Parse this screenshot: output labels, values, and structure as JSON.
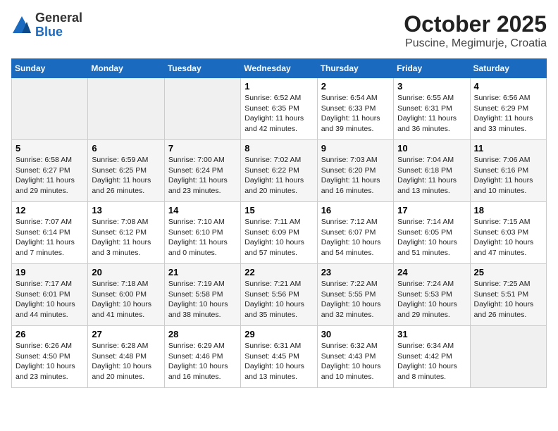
{
  "header": {
    "logo_general": "General",
    "logo_blue": "Blue",
    "title": "October 2025",
    "subtitle": "Puscine, Megimurje, Croatia"
  },
  "days_of_week": [
    "Sunday",
    "Monday",
    "Tuesday",
    "Wednesday",
    "Thursday",
    "Friday",
    "Saturday"
  ],
  "weeks": [
    [
      {
        "num": "",
        "info": ""
      },
      {
        "num": "",
        "info": ""
      },
      {
        "num": "",
        "info": ""
      },
      {
        "num": "1",
        "info": "Sunrise: 6:52 AM\nSunset: 6:35 PM\nDaylight: 11 hours\nand 42 minutes."
      },
      {
        "num": "2",
        "info": "Sunrise: 6:54 AM\nSunset: 6:33 PM\nDaylight: 11 hours\nand 39 minutes."
      },
      {
        "num": "3",
        "info": "Sunrise: 6:55 AM\nSunset: 6:31 PM\nDaylight: 11 hours\nand 36 minutes."
      },
      {
        "num": "4",
        "info": "Sunrise: 6:56 AM\nSunset: 6:29 PM\nDaylight: 11 hours\nand 33 minutes."
      }
    ],
    [
      {
        "num": "5",
        "info": "Sunrise: 6:58 AM\nSunset: 6:27 PM\nDaylight: 11 hours\nand 29 minutes."
      },
      {
        "num": "6",
        "info": "Sunrise: 6:59 AM\nSunset: 6:25 PM\nDaylight: 11 hours\nand 26 minutes."
      },
      {
        "num": "7",
        "info": "Sunrise: 7:00 AM\nSunset: 6:24 PM\nDaylight: 11 hours\nand 23 minutes."
      },
      {
        "num": "8",
        "info": "Sunrise: 7:02 AM\nSunset: 6:22 PM\nDaylight: 11 hours\nand 20 minutes."
      },
      {
        "num": "9",
        "info": "Sunrise: 7:03 AM\nSunset: 6:20 PM\nDaylight: 11 hours\nand 16 minutes."
      },
      {
        "num": "10",
        "info": "Sunrise: 7:04 AM\nSunset: 6:18 PM\nDaylight: 11 hours\nand 13 minutes."
      },
      {
        "num": "11",
        "info": "Sunrise: 7:06 AM\nSunset: 6:16 PM\nDaylight: 11 hours\nand 10 minutes."
      }
    ],
    [
      {
        "num": "12",
        "info": "Sunrise: 7:07 AM\nSunset: 6:14 PM\nDaylight: 11 hours\nand 7 minutes."
      },
      {
        "num": "13",
        "info": "Sunrise: 7:08 AM\nSunset: 6:12 PM\nDaylight: 11 hours\nand 3 minutes."
      },
      {
        "num": "14",
        "info": "Sunrise: 7:10 AM\nSunset: 6:10 PM\nDaylight: 11 hours\nand 0 minutes."
      },
      {
        "num": "15",
        "info": "Sunrise: 7:11 AM\nSunset: 6:09 PM\nDaylight: 10 hours\nand 57 minutes."
      },
      {
        "num": "16",
        "info": "Sunrise: 7:12 AM\nSunset: 6:07 PM\nDaylight: 10 hours\nand 54 minutes."
      },
      {
        "num": "17",
        "info": "Sunrise: 7:14 AM\nSunset: 6:05 PM\nDaylight: 10 hours\nand 51 minutes."
      },
      {
        "num": "18",
        "info": "Sunrise: 7:15 AM\nSunset: 6:03 PM\nDaylight: 10 hours\nand 47 minutes."
      }
    ],
    [
      {
        "num": "19",
        "info": "Sunrise: 7:17 AM\nSunset: 6:01 PM\nDaylight: 10 hours\nand 44 minutes."
      },
      {
        "num": "20",
        "info": "Sunrise: 7:18 AM\nSunset: 6:00 PM\nDaylight: 10 hours\nand 41 minutes."
      },
      {
        "num": "21",
        "info": "Sunrise: 7:19 AM\nSunset: 5:58 PM\nDaylight: 10 hours\nand 38 minutes."
      },
      {
        "num": "22",
        "info": "Sunrise: 7:21 AM\nSunset: 5:56 PM\nDaylight: 10 hours\nand 35 minutes."
      },
      {
        "num": "23",
        "info": "Sunrise: 7:22 AM\nSunset: 5:55 PM\nDaylight: 10 hours\nand 32 minutes."
      },
      {
        "num": "24",
        "info": "Sunrise: 7:24 AM\nSunset: 5:53 PM\nDaylight: 10 hours\nand 29 minutes."
      },
      {
        "num": "25",
        "info": "Sunrise: 7:25 AM\nSunset: 5:51 PM\nDaylight: 10 hours\nand 26 minutes."
      }
    ],
    [
      {
        "num": "26",
        "info": "Sunrise: 6:26 AM\nSunset: 4:50 PM\nDaylight: 10 hours\nand 23 minutes."
      },
      {
        "num": "27",
        "info": "Sunrise: 6:28 AM\nSunset: 4:48 PM\nDaylight: 10 hours\nand 20 minutes."
      },
      {
        "num": "28",
        "info": "Sunrise: 6:29 AM\nSunset: 4:46 PM\nDaylight: 10 hours\nand 16 minutes."
      },
      {
        "num": "29",
        "info": "Sunrise: 6:31 AM\nSunset: 4:45 PM\nDaylight: 10 hours\nand 13 minutes."
      },
      {
        "num": "30",
        "info": "Sunrise: 6:32 AM\nSunset: 4:43 PM\nDaylight: 10 hours\nand 10 minutes."
      },
      {
        "num": "31",
        "info": "Sunrise: 6:34 AM\nSunset: 4:42 PM\nDaylight: 10 hours\nand 8 minutes."
      },
      {
        "num": "",
        "info": ""
      }
    ]
  ]
}
